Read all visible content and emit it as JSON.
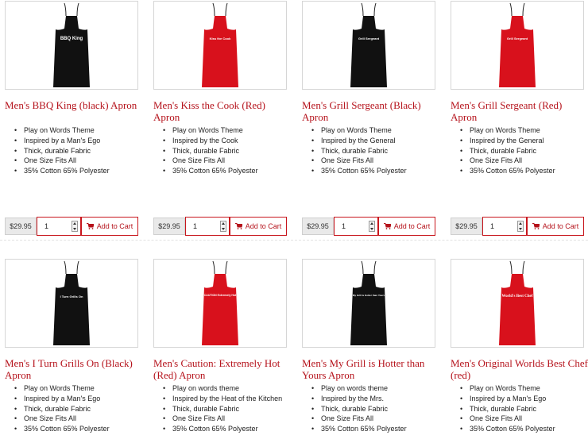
{
  "colors": {
    "accent": "#b5121b",
    "black_apron": "#111111",
    "red_apron": "#d8111c"
  },
  "icons": {
    "add_to_cart": "cart-icon"
  },
  "products": [
    {
      "name": "Men's BBQ King (black) Apron",
      "apron_color": "black",
      "apron_text": "BBQ King",
      "features": [
        "Play on Words Theme",
        "Inspired by a Man's Ego",
        "Thick, durable Fabric",
        "One Size Fits All",
        "35% Cotton 65% Polyester"
      ],
      "price": "$29.95",
      "quantity": "1",
      "cart_label": "Add to Cart"
    },
    {
      "name": "Men's Kiss the Cook (Red) Apron",
      "apron_color": "red",
      "apron_text": "Kiss the Cook",
      "features": [
        "Play on Words Theme",
        "Inspired by the Cook",
        "Thick, durable Fabric",
        "One Size Fits All",
        "35% Cotton 65% Polyester"
      ],
      "price": "$29.95",
      "quantity": "1",
      "cart_label": "Add to Cart"
    },
    {
      "name": "Men's Grill Sergeant (Black) Apron",
      "apron_color": "black",
      "apron_text": "Grill Sergeant",
      "features": [
        "Play on Words Theme",
        "Inspired by the General",
        "Thick, durable Fabric",
        "One Size Fits All",
        "35% Cotton 65% Polyester"
      ],
      "price": "$29.95",
      "quantity": "1",
      "cart_label": "Add to Cart"
    },
    {
      "name": "Men's Grill Sergeant (Red) Apron",
      "apron_color": "red",
      "apron_text": "Grill Sergeant",
      "features": [
        "Play on Words Theme",
        "Inspired by the General",
        "Thick, durable Fabric",
        "One Size Fits All",
        "35% Cotton 65% Polyester"
      ],
      "price": "$29.95",
      "quantity": "1",
      "cart_label": "Add to Cart"
    },
    {
      "name": "Men's I Turn Grills On (Black) Apron",
      "apron_color": "black",
      "apron_text": "I Turn Grills On",
      "features": [
        "Play on Words Theme",
        "Inspired by a Man's Ego",
        "Thick, durable Fabric",
        "One Size Fits All",
        "35% Cotton 65% Polyester"
      ]
    },
    {
      "name": "Men's Caution: Extremely Hot (Red) Apron",
      "apron_color": "red",
      "apron_text": "CAUTION Extremely Hot",
      "features": [
        "Play on words theme",
        "Inspired by the Heat of the Kitchen",
        "Thick, durable Fabric",
        "One Size Fits All",
        "35% Cotton 65% Polyester"
      ]
    },
    {
      "name": "Men's My Grill is Hotter than Yours Apron",
      "apron_color": "black",
      "apron_text": "My Grill is Hotter than Yours",
      "features": [
        "Play on words theme",
        "Inspired by the Mrs.",
        "Thick, durable Fabric",
        "One Size Fits All",
        "35% Cotton 65% Polyester"
      ]
    },
    {
      "name": "Men's Original Worlds Best Chef (red)",
      "apron_color": "red",
      "apron_text": "World's Best Chef",
      "features": [
        "Play on Words Theme",
        "Inspired by a Man's Ego",
        "Thick, durable Fabric",
        "One Size Fits All",
        "35% Cotton 65% Polyester"
      ]
    }
  ]
}
